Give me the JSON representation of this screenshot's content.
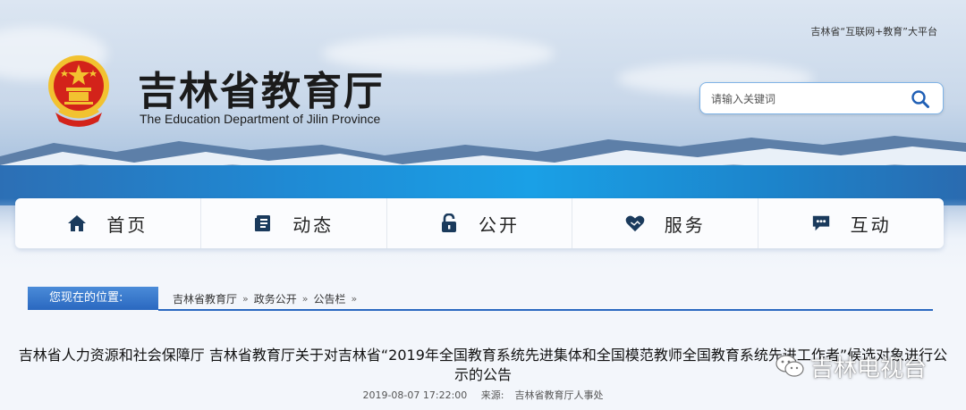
{
  "header": {
    "top_link": "吉林省“互联网+教育”大平台",
    "title": "吉林省教育厅",
    "subtitle": "The Education Department of Jilin Province",
    "emblem_icon": "national-emblem-icon"
  },
  "search": {
    "placeholder": "请输入关键词",
    "icon": "search-icon"
  },
  "nav": {
    "items": [
      {
        "label": "首页",
        "icon": "home-icon"
      },
      {
        "label": "动态",
        "icon": "document-icon"
      },
      {
        "label": "公开",
        "icon": "lock-icon"
      },
      {
        "label": "服务",
        "icon": "handshake-heart-icon"
      },
      {
        "label": "互动",
        "icon": "chat-icon"
      }
    ]
  },
  "breadcrumb": {
    "label": "您现在的位置:",
    "items": [
      "吉林省教育厅",
      "政务公开",
      "公告栏"
    ],
    "separator": "»"
  },
  "article": {
    "title": "吉林省人力资源和社会保障厅 吉林省教育厅关于对吉林省“2019年全国教育系统先进集体和全国模范教师全国教育系统先进工作者”候选对象进行公示的公告",
    "date": "2019-08-07 17:22:00",
    "source_label": "来源:",
    "source": "吉林省教育厅人事处"
  },
  "watermark": {
    "text": "吉林电视台",
    "icon": "wechat-icon"
  },
  "colors": {
    "accent": "#2a68c0",
    "search_border": "#7fb3e6",
    "emblem_red": "#d3231a",
    "emblem_gold": "#f2c230"
  }
}
